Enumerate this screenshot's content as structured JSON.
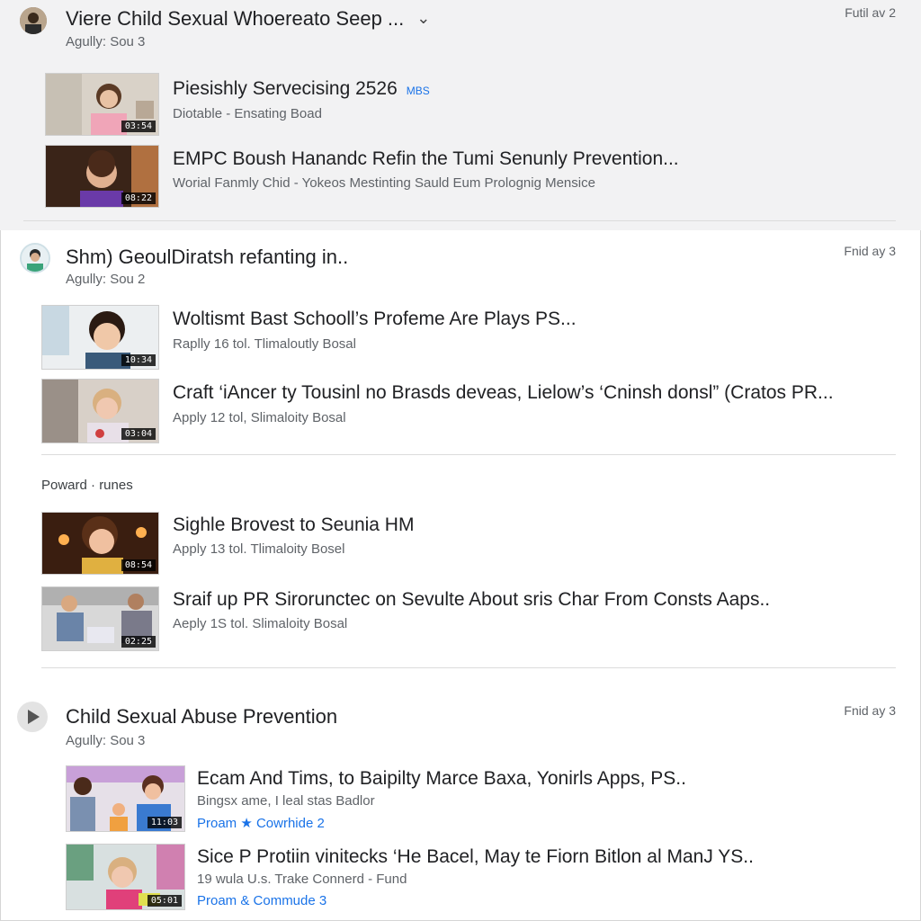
{
  "sections": [
    {
      "title": "Viere Child Sexual Whoereato Seep ...",
      "subtitle": "Agully: Sou 3",
      "date": "Futil av 2",
      "items": [
        {
          "title": "Piesishly Servecising 2526",
          "badge": "MBS",
          "meta": "Diotable - Ensating Boad",
          "duration": "03:54"
        },
        {
          "title": "EMPC Boush Hanandc Refin the Tumi Senunly Prevention...",
          "meta": "Worial Fanmly Chid - Yokeos Mestinting Sauld Eum Prolognig Mensice",
          "duration": "08:22"
        }
      ]
    },
    {
      "title": "Shm) GeoulDiratsh refanting in..",
      "subtitle": "Agully: Sou 2",
      "date": "Fnid ay 3",
      "items": [
        {
          "title": "Woltismt Bast Schooll’s Profeme Are Plays PS...",
          "meta": "Raplly 16 tol. Tlimaloutly Bosal",
          "duration": "10:34"
        },
        {
          "title": "Craft ‘iAncer ty Tousinl no Brasds deveas, Lielow’s ‘Cninsh donsl” (Cratos PR...",
          "meta": "Apply 12 tol, Slimaloity Bosal",
          "duration": "03:04"
        }
      ],
      "group_label": "Poward · runes",
      "group_items": [
        {
          "title": "Sighle Brovest to Seunia HM",
          "meta": "Apply 13 tol. Tlimaloity Bosel",
          "duration": "08:54"
        },
        {
          "title": "Sraif up PR Sirorunctec on Sevulte About sris Char From Consts Aaps..",
          "meta": "Aeply 1S tol. Slimaloity Bosal",
          "duration": "02:25"
        }
      ]
    },
    {
      "title": "Child Sexual Abuse Prevention",
      "subtitle": "Agully: Sou 3",
      "date": "Fnid ay 3",
      "items": [
        {
          "title": "Ecam And Tims, to Baipilty Marce Baxa, Yonirls Apps, PS..",
          "meta": "Bingsx ame, I leal stas Badlor",
          "link": "Proam ★ Cowrhide 2",
          "duration": "11:03"
        },
        {
          "title": "Sice P Protiin vinitecks ‘He Bacel, May te Fiorn Bitlon al ManJ YS..",
          "meta": "19 wula U.s. Trake Connerd - Fund",
          "link": "Proam & Commude 3",
          "duration": "05:01"
        }
      ]
    }
  ],
  "colors": {
    "background": "#ffffff",
    "shaded_section": "#f2f2f3",
    "link": "#1a73e8",
    "muted": "#5f6368"
  },
  "icons": {
    "chevron": "chevron-down-icon",
    "play": "play-icon"
  }
}
